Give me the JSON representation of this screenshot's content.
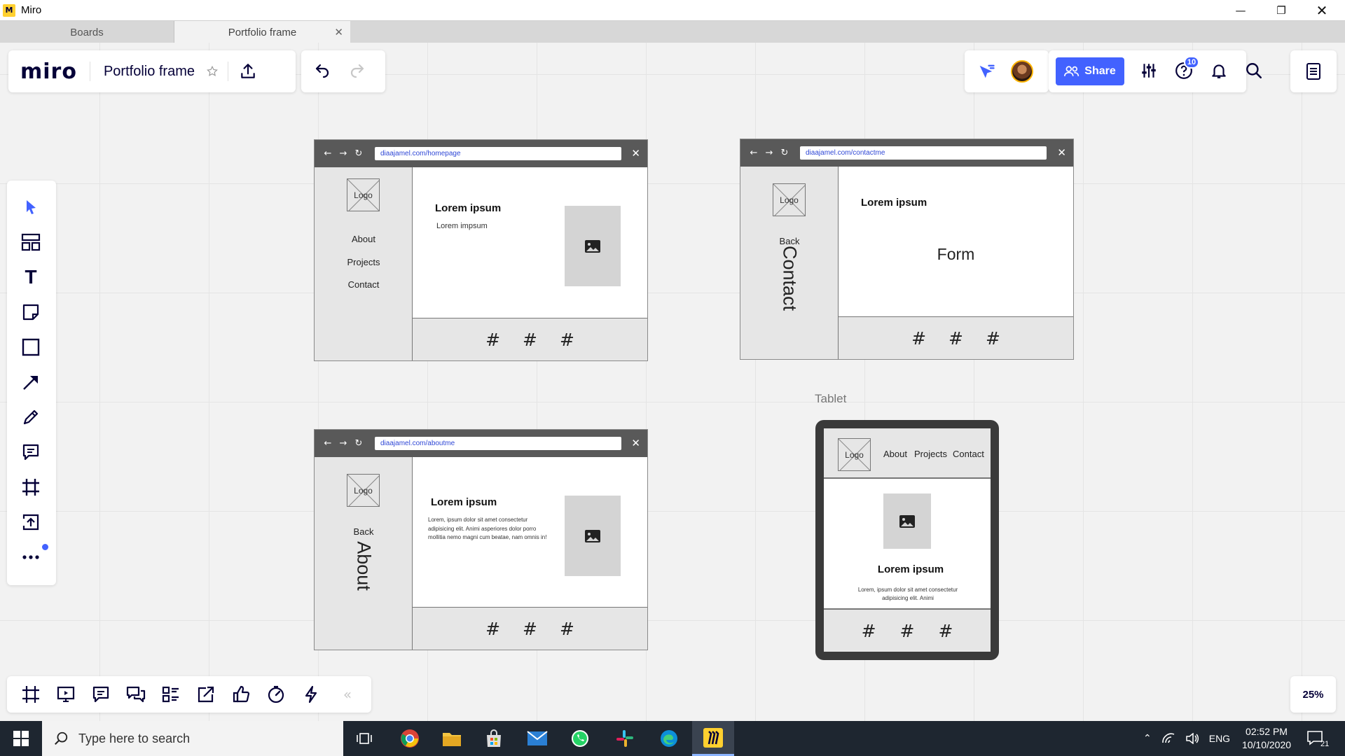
{
  "window": {
    "title": "Miro",
    "app_icon_letter": "M"
  },
  "tabs": [
    {
      "label": "Boards"
    },
    {
      "label": "Portfolio frame"
    }
  ],
  "header": {
    "brand": "miro",
    "board_title": "Portfolio frame",
    "share_label": "Share",
    "notification_count": "10"
  },
  "zoom_level": "25%",
  "colors": {
    "accent": "#4262ff",
    "brand_yellow": "#ffd02f",
    "wire_bar": "#595959"
  },
  "wireframes": {
    "home": {
      "url": "diaajamel.com/homepage",
      "logo": "Logo",
      "nav": [
        "About",
        "Projects",
        "Contact"
      ],
      "title": "Lorem ipsum",
      "subtitle": "Lorem impsum",
      "footer": [
        "#",
        "#",
        "#"
      ]
    },
    "contact": {
      "url": "diaajamel.com/contactme",
      "logo": "Logo",
      "back": "Back",
      "vertical": "Contact",
      "title": "Lorem ipsum",
      "form": "Form",
      "footer": [
        "#",
        "#",
        "#"
      ]
    },
    "about": {
      "url": "diaajamel.com/aboutme",
      "logo": "Logo",
      "back": "Back",
      "vertical": "About",
      "title": "Lorem ipsum",
      "paragraph": "Lorem, ipsum dolor sit amet consectetur adipisicing elit. Animi asperiores dolor porro mollitia nemo magni cum beatae, nam omnis in!",
      "footer": [
        "#",
        "#",
        "#"
      ]
    },
    "tablet": {
      "label": "Tablet",
      "logo": "Logo",
      "nav": [
        "About",
        "Projects",
        "Contact"
      ],
      "title": "Lorem ipsum",
      "paragraph": "Lorem, ipsum dolor sit amet consectetur adipisicing elit. Animi",
      "footer": [
        "#",
        "#",
        "#"
      ]
    }
  },
  "taskbar": {
    "search_placeholder": "Type here to search",
    "language": "ENG",
    "time": "02:52 PM",
    "date": "10/10/2020",
    "notification_count": "21"
  }
}
